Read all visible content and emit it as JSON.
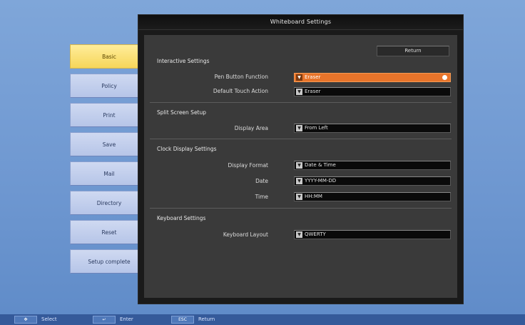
{
  "window": {
    "title": "Whiteboard Settings",
    "return_label": "Return"
  },
  "sidebar": {
    "items": [
      {
        "label": "Basic",
        "active": true
      },
      {
        "label": "Policy",
        "active": false
      },
      {
        "label": "Print",
        "active": false
      },
      {
        "label": "Save",
        "active": false
      },
      {
        "label": "Mail",
        "active": false
      },
      {
        "label": "Directory",
        "active": false
      },
      {
        "label": "Reset",
        "active": false
      },
      {
        "label": "Setup complete",
        "active": false
      }
    ]
  },
  "sections": {
    "interactive": {
      "title": "Interactive Settings",
      "pen_button_label": "Pen Button Function",
      "pen_button_value": "Eraser",
      "touch_label": "Default Touch Action",
      "touch_value": "Eraser"
    },
    "split": {
      "title": "Split Screen Setup",
      "display_area_label": "Display Area",
      "display_area_value": "From Left"
    },
    "clock": {
      "title": "Clock Display Settings",
      "format_label": "Display Format",
      "format_value": "Date & Time",
      "date_label": "Date",
      "date_value": "YYYY-MM-DD",
      "time_label": "Time",
      "time_value": "HH:MM"
    },
    "keyboard": {
      "title": "Keyboard Settings",
      "layout_label": "Keyboard Layout",
      "layout_value": "QWERTY"
    }
  },
  "footer": {
    "select_label": "Select",
    "enter_label": "Enter",
    "return_label": "Return",
    "esc_key": "ESC"
  },
  "colors": {
    "accent": "#e8742a",
    "active_tab": "#f6d65a",
    "background": "#6f98d1"
  }
}
